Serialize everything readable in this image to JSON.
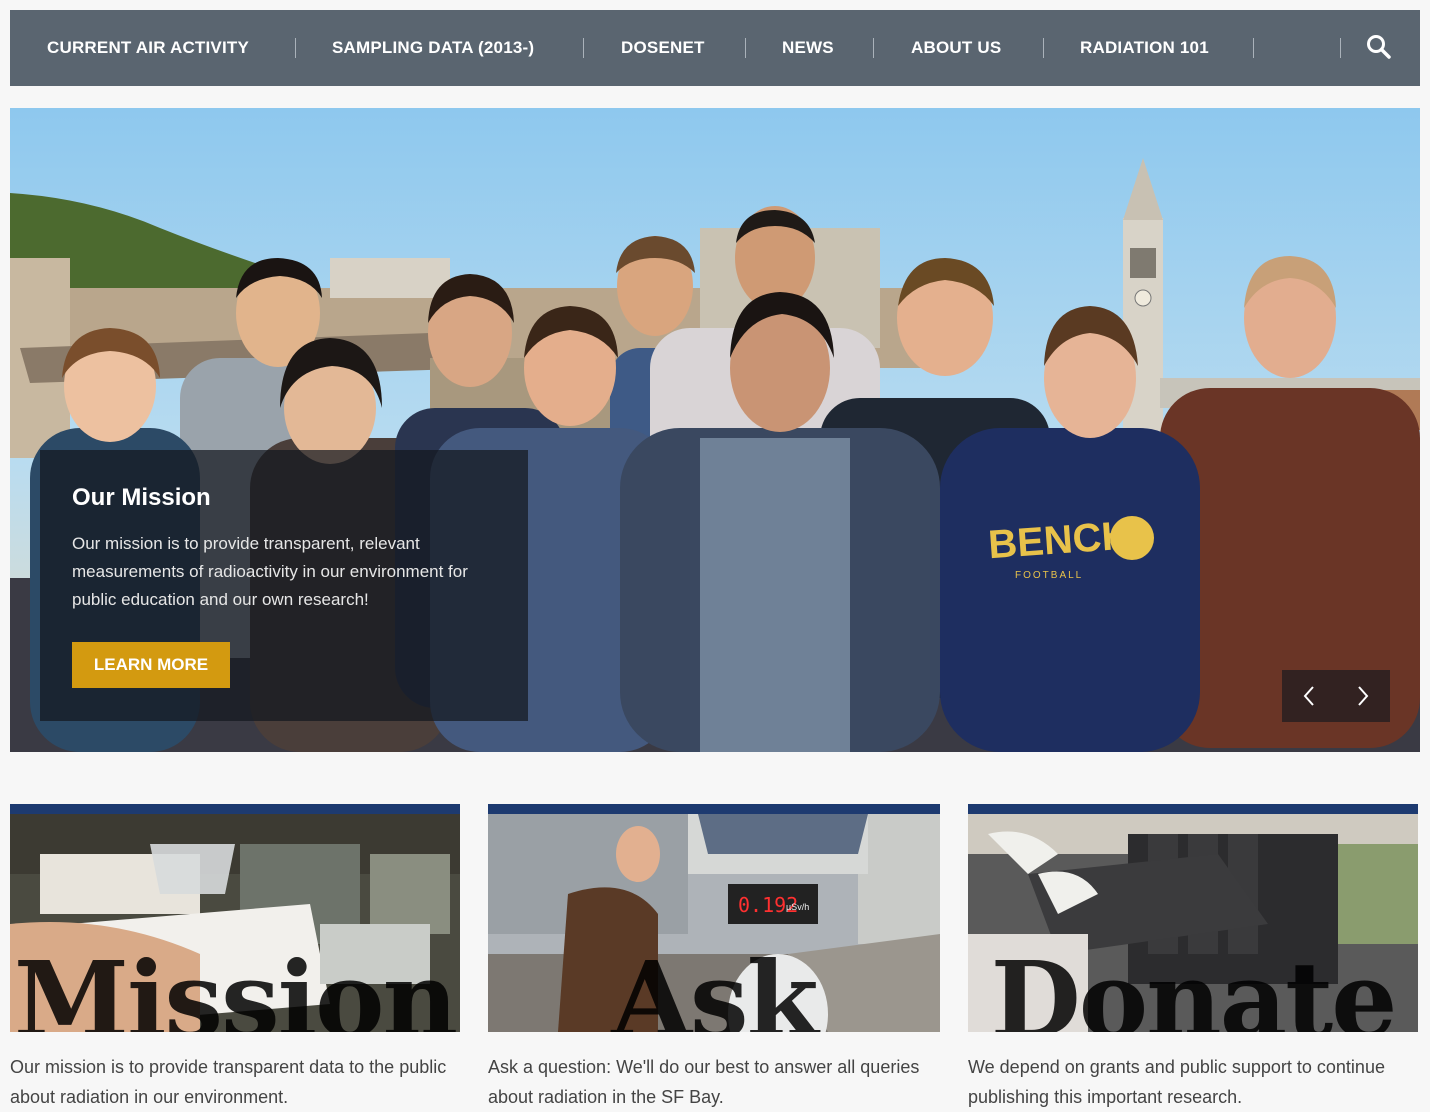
{
  "nav": {
    "items": [
      {
        "label": "CURRENT AIR ACTIVITY"
      },
      {
        "label": "SAMPLING DATA (2013-)"
      },
      {
        "label": "DOSENET"
      },
      {
        "label": "NEWS"
      },
      {
        "label": "ABOUT US"
      },
      {
        "label": "RADIATION 101"
      }
    ],
    "search_icon": "search-icon"
  },
  "hero": {
    "title": "Our Mission",
    "text": "Our mission is to provide transparent, relevant measurements of radioactivity in our environment for public education and our own research!",
    "button": "LEARN MORE",
    "shirt_text": "BENCH",
    "shirt_sub": "FOOTBALL",
    "prev_icon": "chevron-left-icon",
    "next_icon": "chevron-right-icon"
  },
  "cards": [
    {
      "overlay": "Mission",
      "text": "Our mission is to provide transparent data to the public about radiation in our environment."
    },
    {
      "overlay": "Ask",
      "text": "Ask a question: We'll do our best to answer all queries about radiation in the SF Bay.",
      "display_reading": "0.192",
      "display_unit": "µSv/h"
    },
    {
      "overlay": "Donate",
      "text": "We depend on grants and public support to continue publishing this important research."
    }
  ],
  "colors": {
    "nav_bg": "#5a6570",
    "accent": "#d39a10",
    "card_bar": "#1d3a70"
  }
}
